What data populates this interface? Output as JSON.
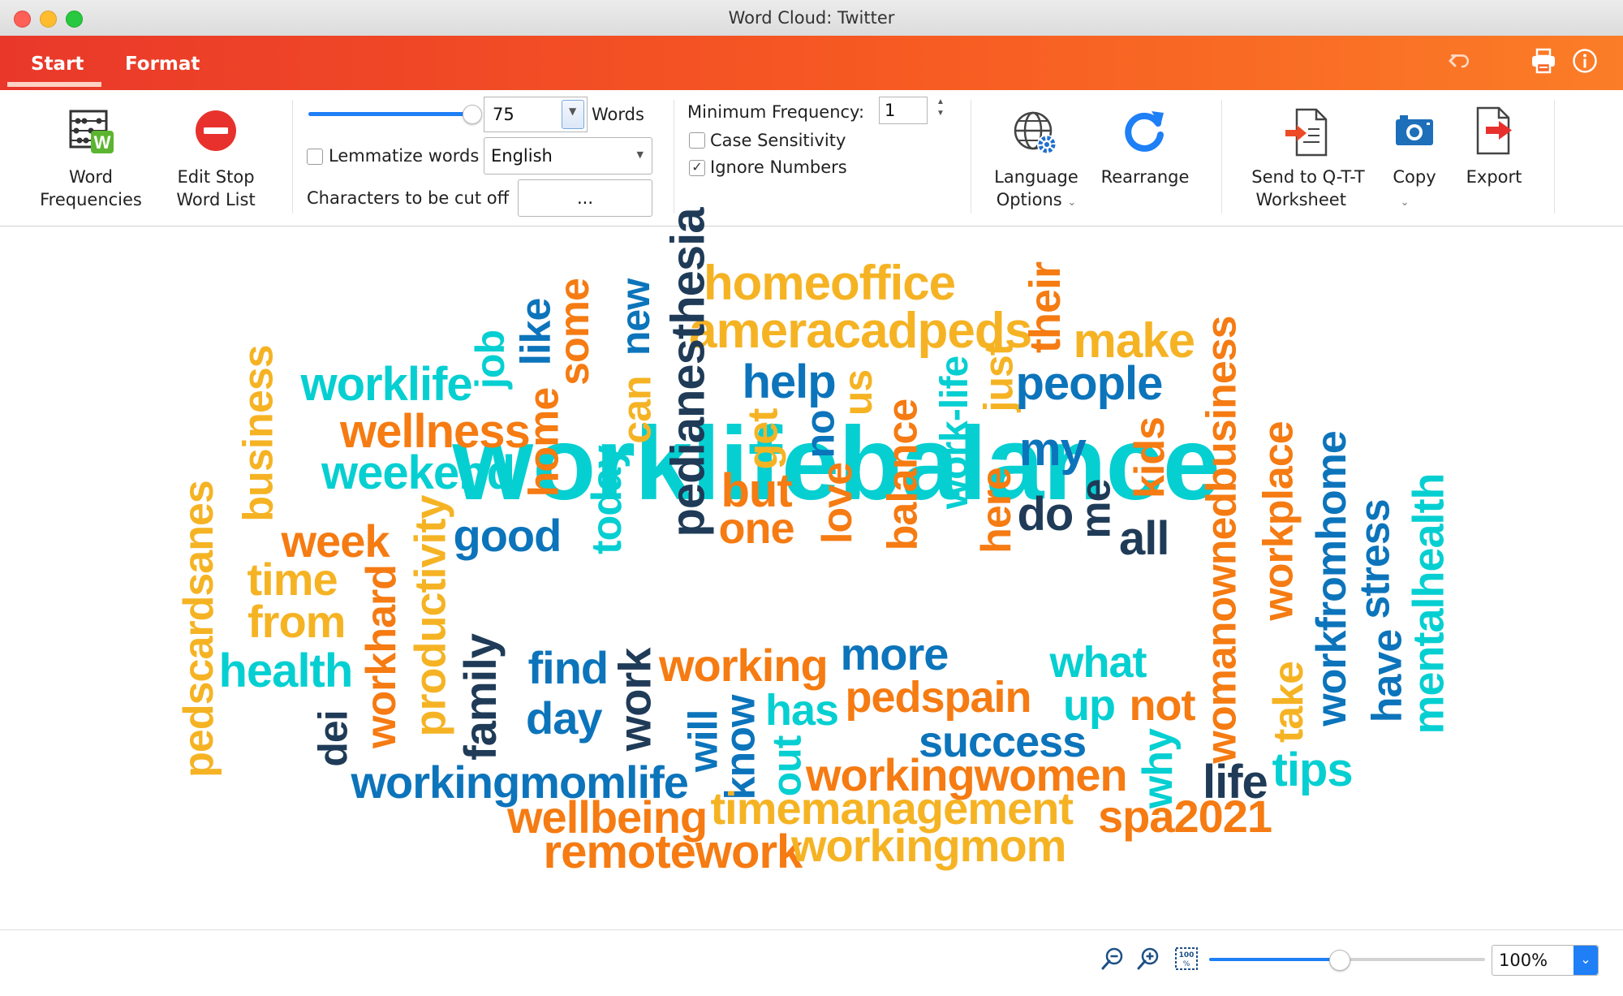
{
  "window": {
    "title": "Word Cloud: Twitter"
  },
  "tabs": {
    "start": "Start",
    "format": "Format"
  },
  "toolbar": {
    "word_frequencies_line1": "Word",
    "word_frequencies_line2": "Frequencies",
    "edit_stop_line1": "Edit Stop",
    "edit_stop_line2": "Word List",
    "words_count": "75",
    "words_label": "Words",
    "word_slider_fraction": 0.98,
    "lemmatize_label": "Lemmatize words",
    "lemmatize_checked": false,
    "language_value": "English",
    "chars_cut_label": "Characters to be cut off",
    "chars_cut_value": "...",
    "min_freq_label": "Minimum Frequency:",
    "min_freq_value": "1",
    "case_sensitivity_label": "Case Sensitivity",
    "case_sensitivity_checked": false,
    "ignore_numbers_label": "Ignore Numbers",
    "ignore_numbers_checked": true,
    "check_mark": "✓",
    "language_options_line1": "Language",
    "language_options_line2": "Options",
    "rearrange_label": "Rearrange",
    "send_qtt_line1": "Send to Q-T-T",
    "send_qtt_line2": "Worksheet",
    "copy_label": "Copy",
    "export_label": "Export"
  },
  "colors": {
    "orange": "#f57b12",
    "gold": "#f5b324",
    "cyan": "#06cfd1",
    "blue": "#0c74bb",
    "navy": "#1f3b57",
    "accent": "#ee4a26"
  },
  "words": [
    {
      "text": "worklifebalance",
      "color": "cyan"
    },
    {
      "text": "homeoffice",
      "color": "gold"
    },
    {
      "text": "ameracadpeds",
      "color": "gold"
    },
    {
      "text": "pedianesthesia",
      "color": "navy"
    },
    {
      "text": "new",
      "color": "blue"
    },
    {
      "text": "can",
      "color": "gold"
    },
    {
      "text": "some",
      "color": "orange"
    },
    {
      "text": "like",
      "color": "blue"
    },
    {
      "text": "job",
      "color": "cyan"
    },
    {
      "text": "worklife",
      "color": "cyan"
    },
    {
      "text": "business",
      "color": "gold"
    },
    {
      "text": "wellness",
      "color": "orange"
    },
    {
      "text": "weekend",
      "color": "cyan"
    },
    {
      "text": "home",
      "color": "orange"
    },
    {
      "text": "today",
      "color": "cyan"
    },
    {
      "text": "help",
      "color": "blue"
    },
    {
      "text": "us",
      "color": "gold"
    },
    {
      "text": "get",
      "color": "gold"
    },
    {
      "text": "no",
      "color": "blue"
    },
    {
      "text": "balance",
      "color": "orange"
    },
    {
      "text": "work-life",
      "color": "cyan"
    },
    {
      "text": "just",
      "color": "gold"
    },
    {
      "text": "their",
      "color": "orange"
    },
    {
      "text": "make",
      "color": "gold"
    },
    {
      "text": "people",
      "color": "blue"
    },
    {
      "text": "womanownedbusiness",
      "color": "orange"
    },
    {
      "text": "my",
      "color": "blue"
    },
    {
      "text": "kids",
      "color": "orange"
    },
    {
      "text": "do",
      "color": "navy"
    },
    {
      "text": "me",
      "color": "navy"
    },
    {
      "text": "all",
      "color": "navy"
    },
    {
      "text": "here",
      "color": "orange"
    },
    {
      "text": "love",
      "color": "orange"
    },
    {
      "text": "but",
      "color": "orange"
    },
    {
      "text": "one",
      "color": "orange"
    },
    {
      "text": "good",
      "color": "blue"
    },
    {
      "text": "productivity",
      "color": "gold"
    },
    {
      "text": "week",
      "color": "orange"
    },
    {
      "text": "time",
      "color": "gold"
    },
    {
      "text": "from",
      "color": "gold"
    },
    {
      "text": "health",
      "color": "cyan"
    },
    {
      "text": "pedscardsanes",
      "color": "gold"
    },
    {
      "text": "workhard",
      "color": "orange"
    },
    {
      "text": "dei",
      "color": "navy"
    },
    {
      "text": "family",
      "color": "navy"
    },
    {
      "text": "find",
      "color": "blue"
    },
    {
      "text": "day",
      "color": "blue"
    },
    {
      "text": "work",
      "color": "navy"
    },
    {
      "text": "working",
      "color": "orange"
    },
    {
      "text": "more",
      "color": "blue"
    },
    {
      "text": "what",
      "color": "cyan"
    },
    {
      "text": "pedspain",
      "color": "orange"
    },
    {
      "text": "up",
      "color": "cyan"
    },
    {
      "text": "not",
      "color": "orange"
    },
    {
      "text": "success",
      "color": "blue"
    },
    {
      "text": "will",
      "color": "blue"
    },
    {
      "text": "know",
      "color": "blue"
    },
    {
      "text": "has",
      "color": "cyan"
    },
    {
      "text": "out",
      "color": "cyan"
    },
    {
      "text": "workingwomen",
      "color": "orange"
    },
    {
      "text": "why",
      "color": "cyan"
    },
    {
      "text": "life",
      "color": "navy"
    },
    {
      "text": "tips",
      "color": "cyan"
    },
    {
      "text": "take",
      "color": "gold"
    },
    {
      "text": "workplace",
      "color": "orange"
    },
    {
      "text": "workfromhome",
      "color": "blue"
    },
    {
      "text": "have",
      "color": "blue"
    },
    {
      "text": "stress",
      "color": "blue"
    },
    {
      "text": "mentalhealth",
      "color": "cyan"
    },
    {
      "text": "workingmomlife",
      "color": "blue"
    },
    {
      "text": "wellbeing",
      "color": "orange"
    },
    {
      "text": "timemanagement",
      "color": "gold"
    },
    {
      "text": "spa2021",
      "color": "orange"
    },
    {
      "text": "remotework",
      "color": "orange"
    },
    {
      "text": "workingmom",
      "color": "gold"
    }
  ],
  "status": {
    "zoom_value": "100%",
    "zoom_slider_fraction": 0.47,
    "zoom_dropdown_glyph": "⌄"
  }
}
